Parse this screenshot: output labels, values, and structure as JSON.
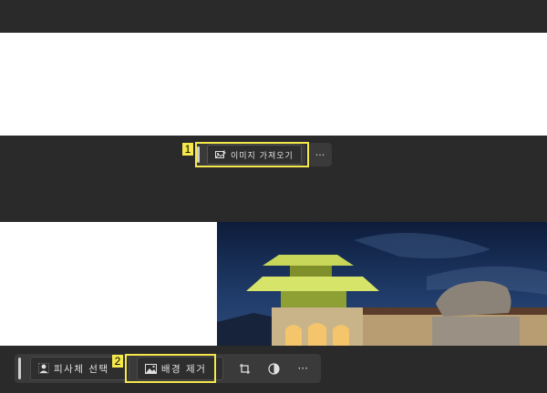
{
  "toolbar_top": {
    "import_image_label": "이미지 가져오기",
    "more_label": "···",
    "marker": "1"
  },
  "toolbar_bottom": {
    "select_subject_label": "피사체 선택",
    "remove_background_label": "배경 제거",
    "more_label": "···",
    "marker": "2"
  },
  "colors": {
    "highlight": "#f5e84a",
    "toolbar_bg": "#3a3a3a",
    "app_bg": "#2a2a2a"
  }
}
